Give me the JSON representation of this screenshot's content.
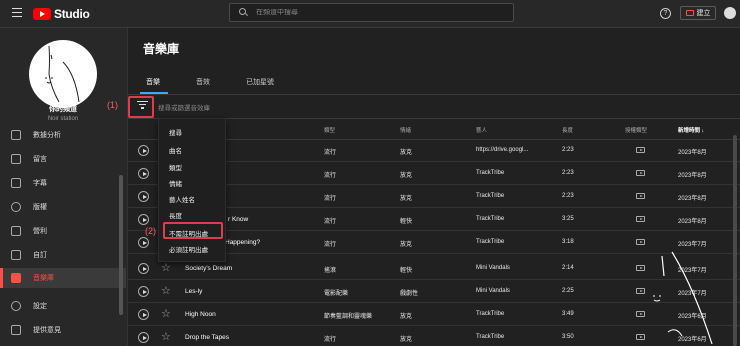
{
  "app": {
    "logo_text": "Studio",
    "brand_color": "#ff0000",
    "accent_color": "#ff4e45",
    "link_color": "#3ea6ff"
  },
  "header": {
    "search_placeholder": "在頻道中搜尋",
    "help_label": "?",
    "create_label": "建立"
  },
  "sidebar": {
    "channel_name": "你的頻道",
    "channel_sub": "Noir station",
    "items": [
      {
        "label": "數據分析",
        "icon": "analytics-icon"
      },
      {
        "label": "留言",
        "icon": "comments-icon"
      },
      {
        "label": "字幕",
        "icon": "subtitles-icon"
      },
      {
        "label": "版權",
        "icon": "copyright-icon"
      },
      {
        "label": "營利",
        "icon": "monetization-icon"
      },
      {
        "label": "自訂",
        "icon": "customization-icon"
      },
      {
        "label": "音樂庫",
        "icon": "audio-library-icon",
        "active": true
      },
      {
        "label": "設定",
        "icon": "settings-icon"
      },
      {
        "label": "提供意見",
        "icon": "feedback-icon"
      }
    ]
  },
  "main": {
    "title": "音樂庫",
    "tabs": [
      {
        "label": "音樂",
        "active": true
      },
      {
        "label": "音效"
      },
      {
        "label": "已加星號"
      }
    ],
    "filter_placeholder": "搜尋或篩選音效庫"
  },
  "table": {
    "columns": [
      "類型",
      "情緒",
      "藝人",
      "長度",
      "授權類型",
      "新增時間"
    ],
    "sort_indicator": "↓",
    "rows": [
      {
        "title": "",
        "genre": "流行",
        "mood": "放克",
        "artist": "https://drive.googl...",
        "duration": "2:23",
        "date": "2023年8月"
      },
      {
        "title": "",
        "genre": "流行",
        "mood": "放克",
        "artist": "TrackTribe",
        "duration": "2:23",
        "date": "2023年8月"
      },
      {
        "title": "",
        "genre": "流行",
        "mood": "放克",
        "artist": "TrackTribe",
        "duration": "2:23",
        "date": "2023年8月"
      },
      {
        "title": "r Know",
        "genre": "流行",
        "mood": "輕快",
        "artist": "TrackTribe",
        "duration": "3:25",
        "date": "2023年8月"
      },
      {
        "title": "Happening?",
        "genre": "流行",
        "mood": "放克",
        "artist": "TrackTribe",
        "duration": "3:18",
        "date": "2023年7月"
      },
      {
        "title": "Society's Dream",
        "genre": "搖滾",
        "mood": "輕快",
        "artist": "Mini Vandals",
        "duration": "2:14",
        "date": "2023年7月"
      },
      {
        "title": "Les-ly",
        "genre": "電影配樂",
        "mood": "戲劇性",
        "artist": "Mini Vandals",
        "duration": "2:25",
        "date": "2023年7月"
      },
      {
        "title": "High Noon",
        "genre": "節奏藍調和靈魂樂",
        "mood": "放克",
        "artist": "TrackTribe",
        "duration": "3:49",
        "date": "2023年6月"
      },
      {
        "title": "Drop the Tapes",
        "genre": "流行",
        "mood": "放克",
        "artist": "TrackTribe",
        "duration": "3:50",
        "date": "2023年6月"
      }
    ]
  },
  "dropdown": {
    "items": [
      "搜尋",
      "曲名",
      "類型",
      "情緒",
      "藝人姓名",
      "長度",
      "不需註明出處",
      "必須註明出處"
    ]
  },
  "annotations": {
    "one": "(1)",
    "two": "(2)",
    "color": "#e23b4f"
  }
}
